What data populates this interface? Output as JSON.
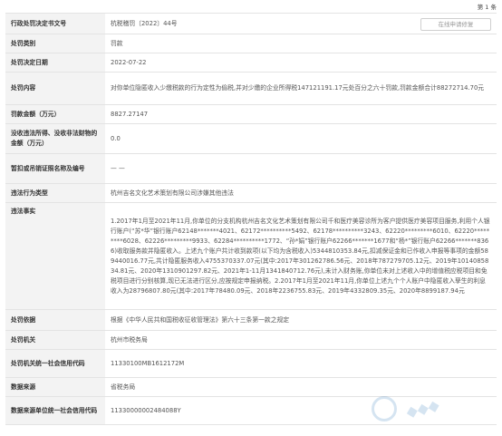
{
  "page": {
    "number": "第 1 条"
  },
  "record": {
    "decision_no": {
      "label": "行政处罚决定书文号",
      "value": "杭税稽罚〔2022〕44号",
      "button": "在线申请修复"
    },
    "category": {
      "label": "处罚类别",
      "value": "罚款"
    },
    "date": {
      "label": "处罚决定日期",
      "value": "2022-07-22"
    },
    "content": {
      "label": "处罚内容",
      "value": "对你单位隐匿收入少缴税款的行为定性为偷税,并对少缴的企业所得税147121191.17元处百分之六十罚款,罚款金额合计88272714.70元"
    },
    "amount": {
      "label": "罚款金额（万元）",
      "value": "8827.27147"
    },
    "confiscated": {
      "label": "没收违法所得、没收非法财物的金额（万元）",
      "value": "0.0"
    },
    "license": {
      "label": "暂扣或吊销证照名称及编号",
      "value": "— —"
    },
    "violation_type": {
      "label": "违法行为类型",
      "value": "杭州吉名文化艺术策划有限公司涉嫌其他违法"
    },
    "facts": {
      "label": "违法事实",
      "value": "1.2017年1月至2021年11月,你单位的分支机构杭州吉名文化艺术策划有限公司千和医疗美容诊所为客户提供医疗美容项目服务,利用个人银行账户(“苏*华”银行账户62148*******4021、62172**********5492、62178**********3243、62220*********6010、62220*********6028、62226*********9933、62284**********1772、“孙*娟”银行账户62266*******1677和“杨*”银行账户62266*******8366)收取服务款并隐匿收入。上述九个账户共计收到款项(以下均为含税收入)5344810353.84元,扣减保证金和已作收入申报等事项的金额589440016.77元,共计隐匿服务收入4755370337.07元(其中:2017年301262786.56元、2018年787279705.12元、2019年1014085834.81元、2020年1310901297.82元、2021年1-11月1341840712.76元),未计入财务账,你单位未对上述收入中的增值税应税项目和免税项目进行分别核算,现已无法进行区分,应按规定申报纳税。2.2017年1月至2021年11月,你单位上述九个个人账户中隐匿收入孳生的利息收入为28796807.80元(其中:2017年78480.09元、2018年2236755.83元、2019年4332809.35元、2020年8899187.94元"
    },
    "basis": {
      "label": "处罚依据",
      "value": "根据《中华人民共和国税收征收管理法》第六十三条第一款之规定"
    },
    "authority": {
      "label": "处罚机关",
      "value": "杭州市税务局"
    },
    "authority_code": {
      "label": "处罚机关统一社会信用代码",
      "value": "11330100MB1612172M"
    },
    "source": {
      "label": "数据来源",
      "value": "省税务局"
    },
    "source_code": {
      "label": "数据来源单位统一社会信用代码",
      "value": "11330000002484088Y"
    }
  }
}
